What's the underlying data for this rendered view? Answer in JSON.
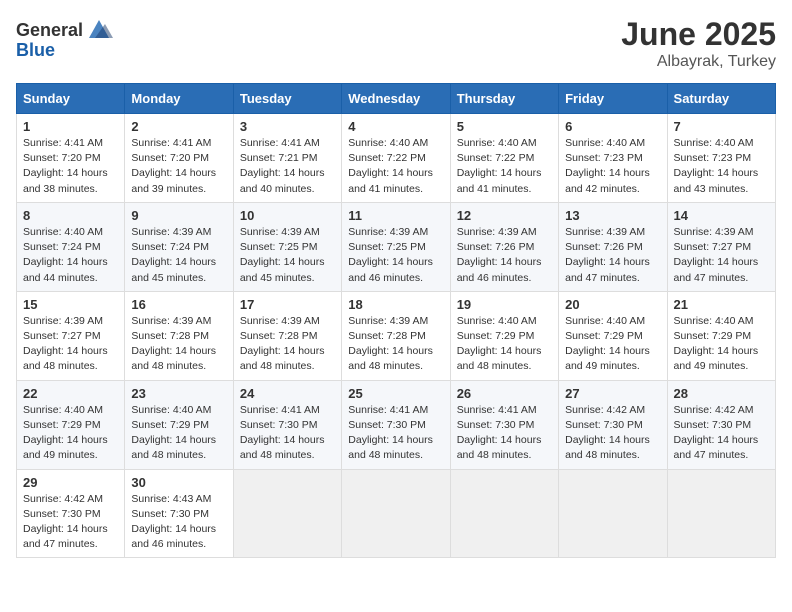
{
  "header": {
    "logo_general": "General",
    "logo_blue": "Blue",
    "month": "June 2025",
    "location": "Albayrak, Turkey"
  },
  "weekdays": [
    "Sunday",
    "Monday",
    "Tuesday",
    "Wednesday",
    "Thursday",
    "Friday",
    "Saturday"
  ],
  "weeks": [
    [
      {
        "day": "1",
        "sunrise": "4:41 AM",
        "sunset": "7:20 PM",
        "daylight": "14 hours and 38 minutes."
      },
      {
        "day": "2",
        "sunrise": "4:41 AM",
        "sunset": "7:20 PM",
        "daylight": "14 hours and 39 minutes."
      },
      {
        "day": "3",
        "sunrise": "4:41 AM",
        "sunset": "7:21 PM",
        "daylight": "14 hours and 40 minutes."
      },
      {
        "day": "4",
        "sunrise": "4:40 AM",
        "sunset": "7:22 PM",
        "daylight": "14 hours and 41 minutes."
      },
      {
        "day": "5",
        "sunrise": "4:40 AM",
        "sunset": "7:22 PM",
        "daylight": "14 hours and 41 minutes."
      },
      {
        "day": "6",
        "sunrise": "4:40 AM",
        "sunset": "7:23 PM",
        "daylight": "14 hours and 42 minutes."
      },
      {
        "day": "7",
        "sunrise": "4:40 AM",
        "sunset": "7:23 PM",
        "daylight": "14 hours and 43 minutes."
      }
    ],
    [
      {
        "day": "8",
        "sunrise": "4:40 AM",
        "sunset": "7:24 PM",
        "daylight": "14 hours and 44 minutes."
      },
      {
        "day": "9",
        "sunrise": "4:39 AM",
        "sunset": "7:24 PM",
        "daylight": "14 hours and 45 minutes."
      },
      {
        "day": "10",
        "sunrise": "4:39 AM",
        "sunset": "7:25 PM",
        "daylight": "14 hours and 45 minutes."
      },
      {
        "day": "11",
        "sunrise": "4:39 AM",
        "sunset": "7:25 PM",
        "daylight": "14 hours and 46 minutes."
      },
      {
        "day": "12",
        "sunrise": "4:39 AM",
        "sunset": "7:26 PM",
        "daylight": "14 hours and 46 minutes."
      },
      {
        "day": "13",
        "sunrise": "4:39 AM",
        "sunset": "7:26 PM",
        "daylight": "14 hours and 47 minutes."
      },
      {
        "day": "14",
        "sunrise": "4:39 AM",
        "sunset": "7:27 PM",
        "daylight": "14 hours and 47 minutes."
      }
    ],
    [
      {
        "day": "15",
        "sunrise": "4:39 AM",
        "sunset": "7:27 PM",
        "daylight": "14 hours and 48 minutes."
      },
      {
        "day": "16",
        "sunrise": "4:39 AM",
        "sunset": "7:28 PM",
        "daylight": "14 hours and 48 minutes."
      },
      {
        "day": "17",
        "sunrise": "4:39 AM",
        "sunset": "7:28 PM",
        "daylight": "14 hours and 48 minutes."
      },
      {
        "day": "18",
        "sunrise": "4:39 AM",
        "sunset": "7:28 PM",
        "daylight": "14 hours and 48 minutes."
      },
      {
        "day": "19",
        "sunrise": "4:40 AM",
        "sunset": "7:29 PM",
        "daylight": "14 hours and 48 minutes."
      },
      {
        "day": "20",
        "sunrise": "4:40 AM",
        "sunset": "7:29 PM",
        "daylight": "14 hours and 49 minutes."
      },
      {
        "day": "21",
        "sunrise": "4:40 AM",
        "sunset": "7:29 PM",
        "daylight": "14 hours and 49 minutes."
      }
    ],
    [
      {
        "day": "22",
        "sunrise": "4:40 AM",
        "sunset": "7:29 PM",
        "daylight": "14 hours and 49 minutes."
      },
      {
        "day": "23",
        "sunrise": "4:40 AM",
        "sunset": "7:29 PM",
        "daylight": "14 hours and 48 minutes."
      },
      {
        "day": "24",
        "sunrise": "4:41 AM",
        "sunset": "7:30 PM",
        "daylight": "14 hours and 48 minutes."
      },
      {
        "day": "25",
        "sunrise": "4:41 AM",
        "sunset": "7:30 PM",
        "daylight": "14 hours and 48 minutes."
      },
      {
        "day": "26",
        "sunrise": "4:41 AM",
        "sunset": "7:30 PM",
        "daylight": "14 hours and 48 minutes."
      },
      {
        "day": "27",
        "sunrise": "4:42 AM",
        "sunset": "7:30 PM",
        "daylight": "14 hours and 48 minutes."
      },
      {
        "day": "28",
        "sunrise": "4:42 AM",
        "sunset": "7:30 PM",
        "daylight": "14 hours and 47 minutes."
      }
    ],
    [
      {
        "day": "29",
        "sunrise": "4:42 AM",
        "sunset": "7:30 PM",
        "daylight": "14 hours and 47 minutes."
      },
      {
        "day": "30",
        "sunrise": "4:43 AM",
        "sunset": "7:30 PM",
        "daylight": "14 hours and 46 minutes."
      },
      null,
      null,
      null,
      null,
      null
    ]
  ]
}
